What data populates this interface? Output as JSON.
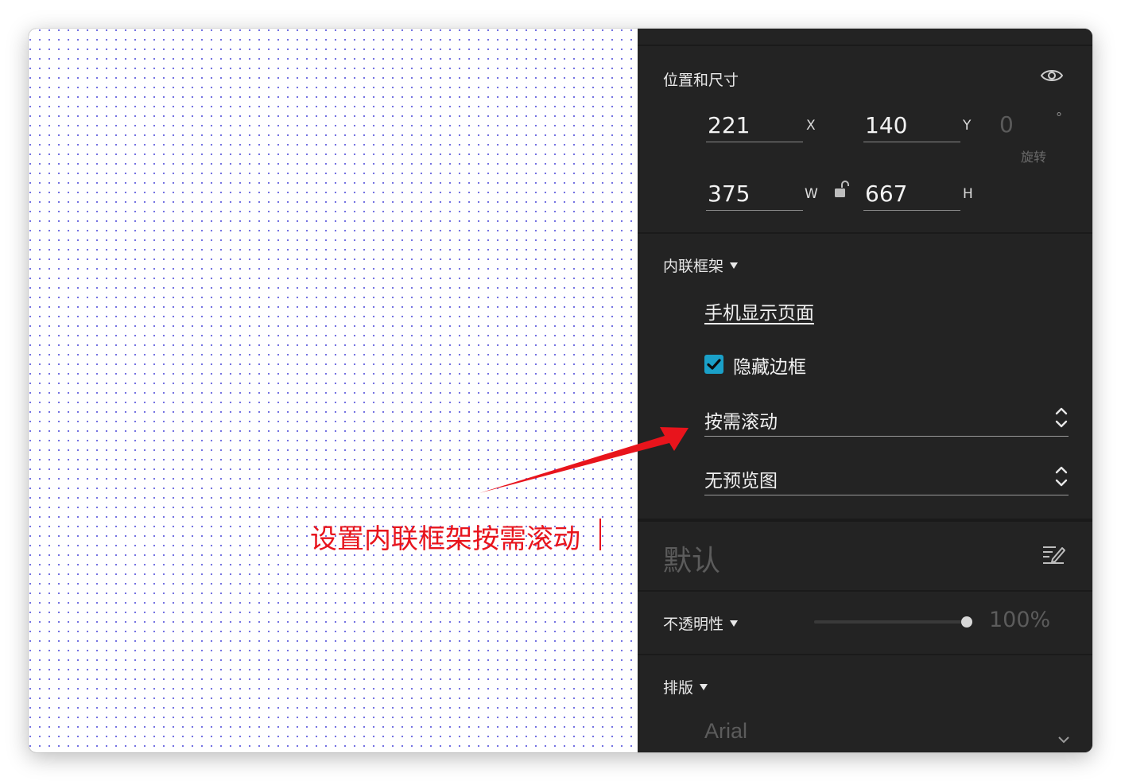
{
  "position_size": {
    "title": "位置和尺寸",
    "x_value": "221",
    "x_label": "X",
    "y_value": "140",
    "y_label": "Y",
    "rotation_value": "0",
    "rotation_unit": "°",
    "rotation_label": "旋转",
    "w_value": "375",
    "w_label": "W",
    "h_value": "667",
    "h_label": "H"
  },
  "inline_frame": {
    "title": "内联框架",
    "link_label": "手机显示页面",
    "hide_border_label": "隐藏边框",
    "hide_border_checked": true,
    "scroll_select": "按需滚动",
    "preview_select": "无预览图"
  },
  "style": {
    "name": "默认"
  },
  "opacity": {
    "title": "不透明性",
    "value_text": "100%",
    "value": 100
  },
  "typography": {
    "title": "排版",
    "font_value": "Arial"
  },
  "annotation": {
    "text": "设置内联框架按需滚动"
  },
  "colors": {
    "panel_bg": "#232323",
    "accent_checkbox": "#1aa0c8",
    "annotation_red": "#e8141c",
    "grid_dot": "#6d6ae0"
  }
}
